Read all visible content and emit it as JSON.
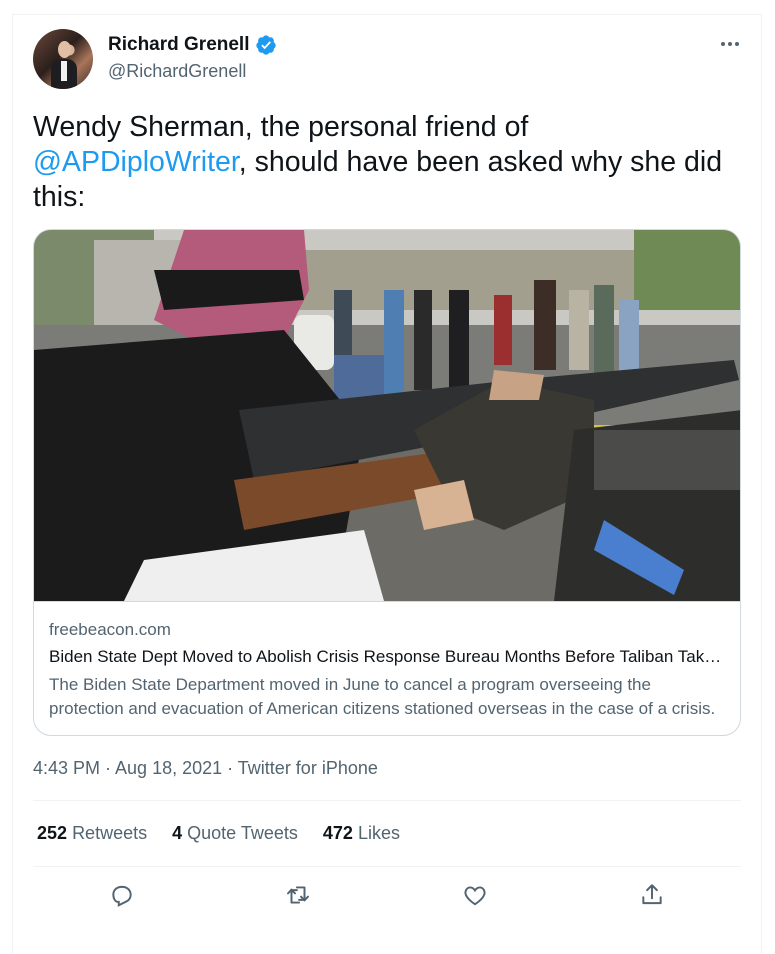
{
  "tweet": {
    "author_name": "Richard Grenell",
    "author_handle": "@RichardGrenell",
    "text_before": "Wendy Sherman, the personal friend of ",
    "mention": "@APDiploWriter",
    "text_after": ", should have been asked why she did this:",
    "timestamp": "4:43 PM · Aug 18, 2021 · Twitter for iPhone"
  },
  "card": {
    "domain": "freebeacon.com",
    "title": "Biden State Dept Moved to Abolish Crisis Response Bureau Months Before Taliban Takeover",
    "description": "The Biden State Department moved in June to cancel a program overseeing the protection and evacuation of American citizens stationed overseas in the case of a crisis."
  },
  "stats": {
    "retweets_count": "252",
    "retweets_label": "Retweets",
    "quotes_count": "4",
    "quotes_label": "Quote Tweets",
    "likes_count": "472",
    "likes_label": "Likes"
  },
  "colors": {
    "accent": "#1d9bf0",
    "text": "#0f1419",
    "secondary": "#536471",
    "border": "#cfd9de"
  },
  "icons": [
    "verified-badge-icon",
    "more-icon",
    "reply-icon",
    "retweet-icon",
    "like-icon",
    "share-icon"
  ]
}
